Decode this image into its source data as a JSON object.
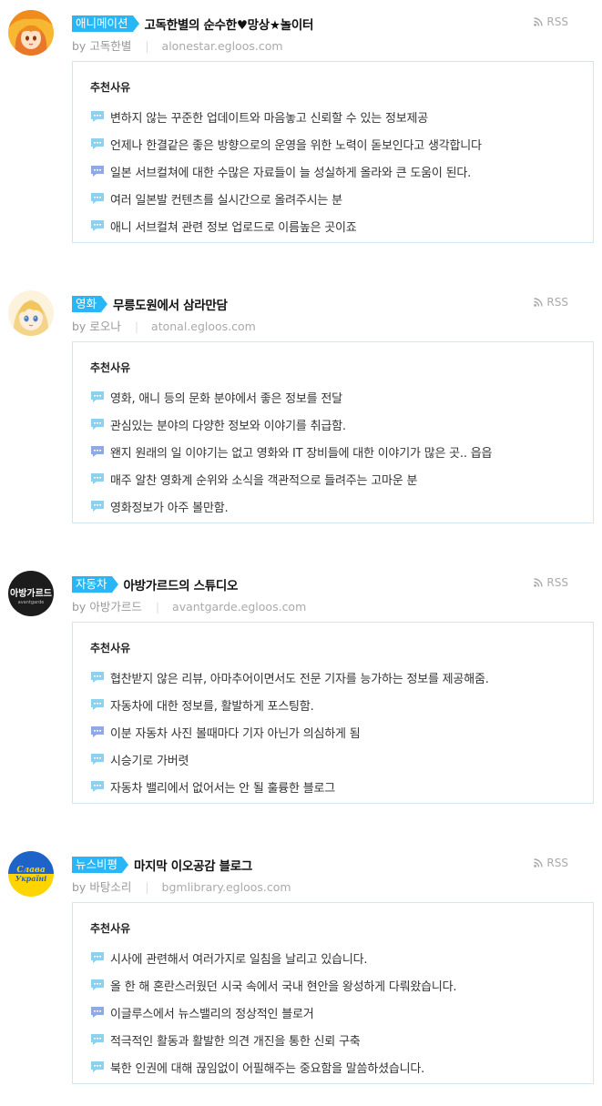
{
  "reason_heading": "추천사유",
  "rss_label": "RSS",
  "colors": {
    "accent": "#29b6f6",
    "bubble": "#8ed1ef",
    "bubble_alt": "#8fa8e6",
    "border": "#d3e6f0"
  },
  "blogs": [
    {
      "category": "애니메이션",
      "title": "고독한별의 순수한♥망상★놀이터",
      "author_prefix": "by",
      "author": "고독한별",
      "url": "alonestar.egloos.com",
      "avatar_icon": "anime-girl-avatar",
      "reasons": [
        "변하지 않는 꾸준한 업데이트와 마음놓고 신뢰할 수 있는 정보제공",
        "언제나 한결같은 좋은 방향으로의 운영을 위한 노력이 돋보인다고 생각합니다",
        "일본 서브컬쳐에 대한 수많은 자료들이 늘 성실하게 올라와 큰 도움이 된다.",
        "여러 일본발 컨텐츠를 실시간으로 올려주시는 분",
        "애니 서브컬쳐 관련 정보 업로드로 이름높은 곳이죠"
      ]
    },
    {
      "category": "영화",
      "title": "무릉도원에서 삼라만담",
      "author_prefix": "by",
      "author": "로오나",
      "url": "atonal.egloos.com",
      "avatar_icon": "blonde-girl-avatar",
      "reasons": [
        "영화, 애니 등의 문화 분야에서 좋은 정보를 전달",
        "관심있는 분야의 다양한 정보와 이야기를 취급함.",
        "왠지 원래의 일 이야기는 없고 영화와 IT 장비들에 대한 이야기가 많은 곳.. 읍읍",
        "매주 알찬 영화계 순위와 소식을 객관적으로 들려주는 고마운 분",
        "영화정보가 아주 볼만함."
      ]
    },
    {
      "category": "자동차",
      "title": "아방가르드의 스튜디오",
      "author_prefix": "by",
      "author": "아방가르드",
      "url": "avantgarde.egloos.com",
      "avatar_icon": "avantgarde-logo-avatar",
      "avatar_text_main": "아방가르드",
      "avatar_text_sub": "avantgarde",
      "reasons": [
        "협찬받지 않은 리뷰, 아마추어이면서도 전문 기자를 능가하는 정보를 제공해줌.",
        "자동차에 대한 정보를, 활발하게 포스팅함.",
        "이분 자동차 사진 볼때마다 기자 아닌가 의심하게 됨",
        "시승기로 가버렷",
        "자동차 밸리에서 없어서는 안 될 훌륭한 블로그"
      ]
    },
    {
      "category": "뉴스비평",
      "title": "마지막 이오공감 블로그",
      "author_prefix": "by",
      "author": "바탕소리",
      "url": "bgmlibrary.egloos.com",
      "avatar_icon": "ukraine-flag-avatar",
      "avatar_text_main": "Слава",
      "avatar_text_sub": "Україні",
      "reasons": [
        "시사에 관련해서 여러가지로 일침을 날리고 있습니다.",
        "올 한 해 혼란스러웠던 시국 속에서 국내 현안을 왕성하게 다뤄왔습니다.",
        "이글루스에서 뉴스밸리의 정상적인 블로거",
        "적극적인 활동과 활발한 의견 개진을 통한 신뢰 구축",
        "북한 인권에 대해 끊임없이 어필해주는 중요함을 말씀하셨습니다."
      ]
    }
  ]
}
